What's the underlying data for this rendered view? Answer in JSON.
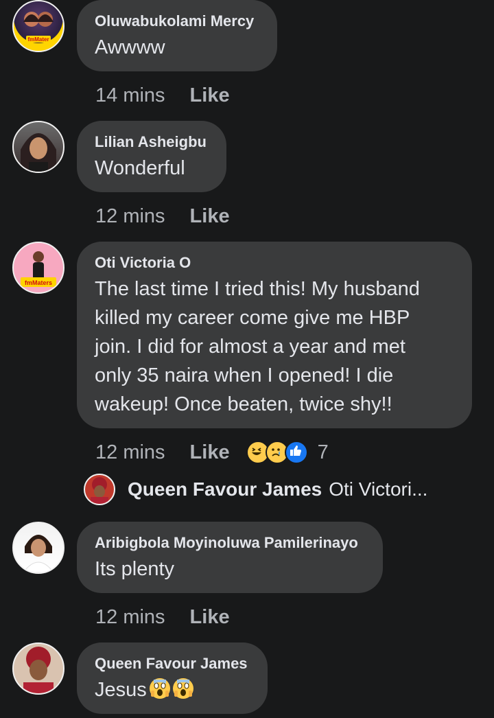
{
  "comments": [
    {
      "name": "Oluwabukolami Mercy",
      "text": "Awwww",
      "time": "14 mins",
      "like_label": "Like",
      "avatar_label": "fmMater"
    },
    {
      "name": "Lilian Asheigbu",
      "text": "Wonderful",
      "time": "12 mins",
      "like_label": "Like"
    },
    {
      "name": "Oti Victoria O",
      "text_lines": [
        "The last time I tried this! My husband",
        "killed my career come give me HBP",
        "join. I did for almost a year and met",
        "only 35 naira when I opened! I die",
        "wakeup! Once beaten, twice shy!!"
      ],
      "time": "12 mins",
      "like_label": "Like",
      "reaction_count": "7",
      "reactions": [
        "laughing-icon",
        "sad-icon",
        "thumbs-up-icon"
      ],
      "avatar_label": "fmMaters"
    },
    {
      "name": "Aribigbola Moyinoluwa Pamilerinayo",
      "text": "Its plenty",
      "time": "12 mins",
      "like_label": "Like"
    },
    {
      "name": "Queen Favour James",
      "text": "Jesus",
      "emojis": [
        "screaming-face-icon",
        "screaming-face-icon"
      ]
    }
  ],
  "reply_preview": {
    "name": "Queen Favour James",
    "text": "Oti Victori..."
  },
  "colors": {
    "background": "#18191a",
    "bubble": "#3a3b3c",
    "text": "#e4e6eb",
    "meta": "#b0b3b8",
    "like_reaction": "#1877f2",
    "emoji_yellow": "#ffcc4d"
  }
}
